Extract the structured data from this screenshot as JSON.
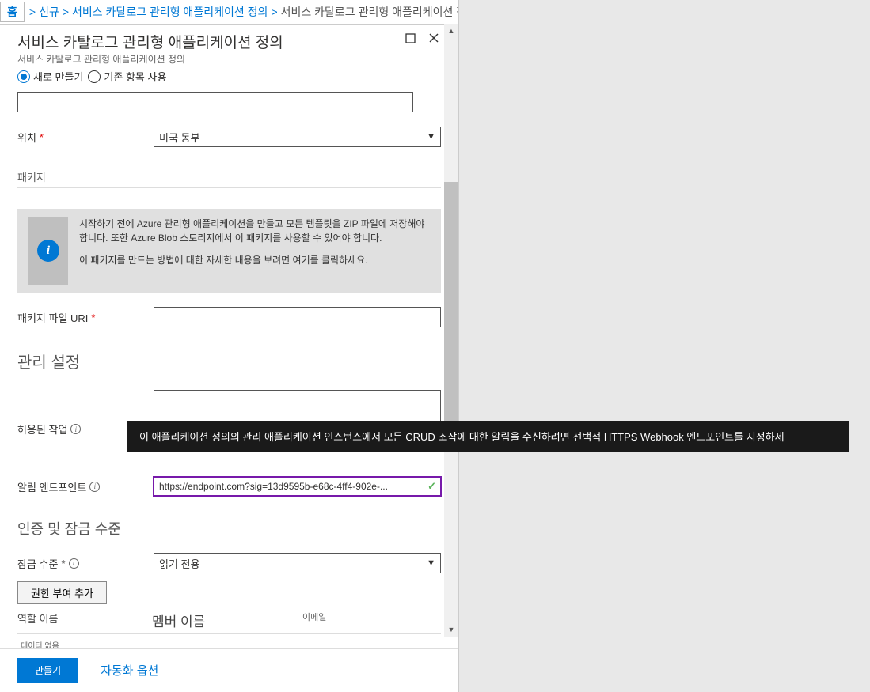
{
  "breadcrumb": {
    "home": "홈",
    "items": [
      "신규",
      "서비스 카탈로그 관리형 애플리케이션 정의"
    ],
    "current": "서비스 카탈로그 관리형 애플리케이션 정의"
  },
  "panel": {
    "title": "서비스 카탈로그 관리형 애플리케이션 정의",
    "subtitle": "서비스 카탈로그 관리형 애플리케이션 정의"
  },
  "radio": {
    "createNewLabel": "새로 만들기",
    "useExistingLabel": "기존 항목 사용"
  },
  "form": {
    "nameValue": "",
    "locationLabel": "위치",
    "locationValue": "미국 동부",
    "packageSection": "패키지",
    "infoBox": {
      "p1": "시작하기 전에 Azure 관리형 애플리케이션을 만들고 모든 템플릿을 ZIP 파일에 저장해야 합니다. 또한 Azure Blob 스토리지에서 이 패키지를 사용할 수 있어야 합니다.",
      "p2": "이 패키지를 만드는 방법에 대한 자세한 내용을 보려면 여기를 클릭하세요."
    },
    "packageUriLabel": "패키지 파일 URI",
    "mgmtSection": "관리 설정",
    "allowedOpsLabel": "허용된 작업",
    "notifEndpointLabel": "알림 엔드포인트",
    "notifEndpointValue": "https://endpoint.com?sig=13d9595b-e68c-4ff4-902e-...",
    "authSection": "인증 및 잠금 수준",
    "lockLevelLabel": "잠금 수준",
    "lockLevelValue": "읽기 전용",
    "addAuthBtn": "권한 부여 추가",
    "tableHeaders": {
      "role": "역할 이름",
      "member": "멤버 이름",
      "email": "이메일"
    },
    "noData": "데이터 없음"
  },
  "tooltip": "이 애플리케이션 정의의 관리 애플리케이션 인스턴스에서 모든 CRUD 조작에 대한 알림을 수신하려면 선택적 HTTPS Webhook 엔드포인트를 지정하세",
  "footer": {
    "createBtn": "만들기",
    "autoLink": "자동화 옵션"
  },
  "icons": {
    "infoChar": "i"
  }
}
